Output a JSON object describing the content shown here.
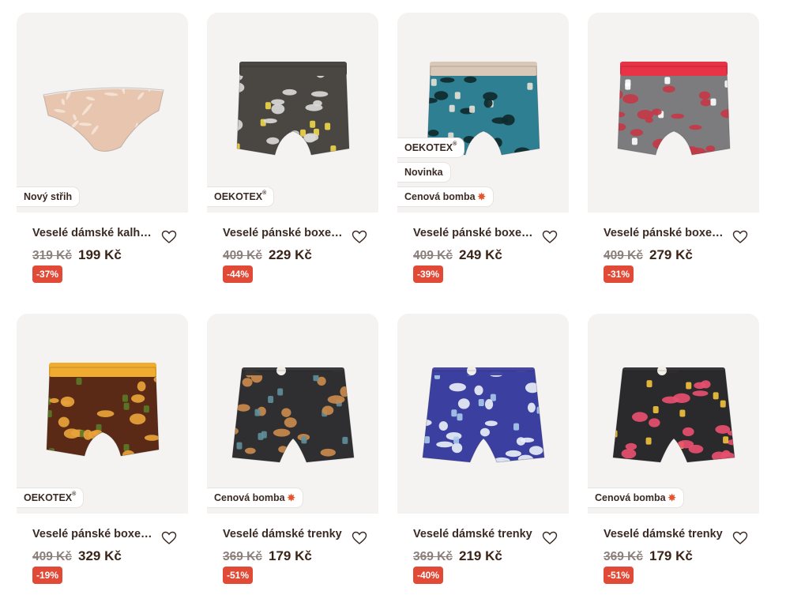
{
  "products": [
    {
      "title": "Veselé dámské kalhotky",
      "old_price": "319 Kč",
      "new_price": "199 Kč",
      "discount": "-37%",
      "badges": [
        "Nový střih"
      ],
      "type": "briefs",
      "colors": {
        "base": "#e7c5ae",
        "pattern": "#f6e8dc",
        "band": "#f2f0ee"
      }
    },
    {
      "title": "Veselé pánské boxerky",
      "old_price": "409 Kč",
      "new_price": "229 Kč",
      "discount": "-44%",
      "badges": [
        "OEKOTEX"
      ],
      "type": "boxer",
      "colors": {
        "base": "#4a4641",
        "pattern": "#d8d8d6",
        "band": "#4a4641",
        "accent": "#f1d64a"
      }
    },
    {
      "title": "Veselé pánské boxerky",
      "old_price": "409 Kč",
      "new_price": "249 Kč",
      "discount": "-39%",
      "badges": [
        "OEKOTEX",
        "Novinka",
        "Cenová bomba"
      ],
      "type": "boxer",
      "colors": {
        "base": "#2f7f92",
        "pattern": "#0f2a2e",
        "band": "#d9c7b7",
        "accent": "#e8e2d6"
      }
    },
    {
      "title": "Veselé pánské boxerky",
      "old_price": "409 Kč",
      "new_price": "279 Kč",
      "discount": "-31%",
      "badges": [],
      "type": "boxer",
      "colors": {
        "base": "#7c7c7e",
        "pattern": "#c33a47",
        "band": "#e83245",
        "accent": "#ffffff"
      }
    },
    {
      "title": "Veselé pánské boxerky",
      "old_price": "409 Kč",
      "new_price": "329 Kč",
      "discount": "-19%",
      "badges": [
        "OEKOTEX"
      ],
      "type": "boxer",
      "colors": {
        "base": "#5a2a17",
        "pattern": "#e7a33a",
        "band": "#f0ac2e",
        "accent": "#5a7a27"
      }
    },
    {
      "title": "Veselé dámské trenky",
      "old_price": "369 Kč",
      "new_price": "179 Kč",
      "discount": "-51%",
      "badges": [
        "Cenová bomba"
      ],
      "type": "shorts",
      "colors": {
        "base": "#2f2f31",
        "pattern": "#c98a4b",
        "band": "#2f2f31",
        "accent": "#5f8f9c"
      }
    },
    {
      "title": "Veselé dámské trenky",
      "old_price": "369 Kč",
      "new_price": "219 Kč",
      "discount": "-40%",
      "badges": [],
      "type": "shorts",
      "colors": {
        "base": "#3b3fa0",
        "pattern": "#e9eef7",
        "band": "#3b3fa0",
        "accent": "#a9c9ea"
      }
    },
    {
      "title": "Veselé dámské trenky",
      "old_price": "369 Kč",
      "new_price": "179 Kč",
      "discount": "-51%",
      "badges": [
        "Cenová bomba"
      ],
      "type": "shorts",
      "colors": {
        "base": "#2a2a2c",
        "pattern": "#e84f6f",
        "band": "#2a2a2c",
        "accent": "#f3c33c"
      }
    }
  ]
}
